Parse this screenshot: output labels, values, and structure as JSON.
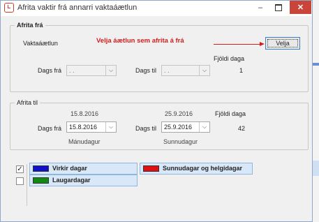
{
  "window": {
    "title": "Afrita vaktir frá annarri vaktaáætlun",
    "controls": {
      "minimize": "–",
      "close": "✕"
    },
    "icon": "clock-app-icon"
  },
  "copy_from": {
    "legend": "Afrita frá",
    "plan_label": "Vaktaáætlun",
    "annotation": "Velja áætlun sem afrita á frá",
    "select_button": "Velja",
    "days_label": "Fjöldi daga",
    "from_label": "Dags frá",
    "from_value": " .  .",
    "to_label": "Dags til",
    "to_value": " .  .",
    "days_value": "1"
  },
  "copy_to": {
    "legend": "Afrita til",
    "from_date_text": "15.8.2016",
    "to_date_text": "25.9.2016",
    "days_label": "Fjöldi daga",
    "from_label": "Dags frá",
    "from_value": "15.8.2016",
    "to_label": "Dags til",
    "to_value": "25.9.2016",
    "days_value": "42",
    "from_weekday": "Mánudagur",
    "to_weekday": "Sunnudagur"
  },
  "day_types": [
    {
      "label": "Virkir dagar",
      "color": "#1010c8",
      "checked": true
    },
    {
      "label": "Sunnudagar og helgidagar",
      "color": "#e01010"
    },
    {
      "label": "Laugardagar",
      "color": "#108a10",
      "checked": false
    }
  ],
  "colors": {
    "annotation": "#d51d1d",
    "close_button": "#c9453a"
  }
}
